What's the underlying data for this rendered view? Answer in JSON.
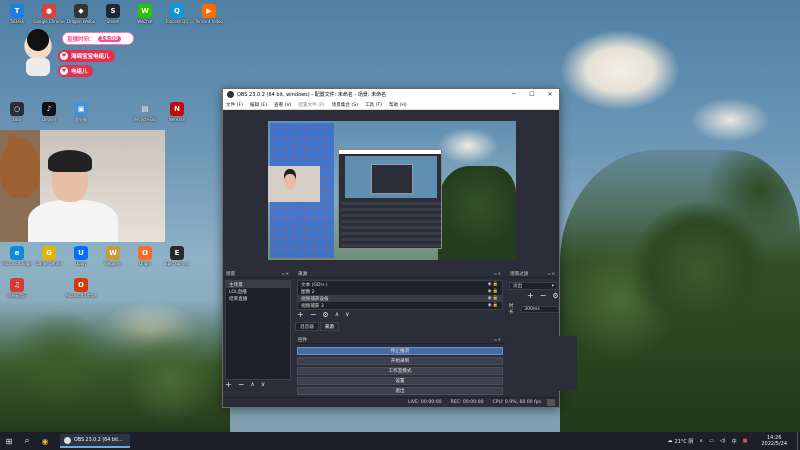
{
  "desktop": {
    "icons": [
      {
        "label": "ToDesk",
        "color": "#1e7de0",
        "glyph": "T"
      },
      {
        "label": "Google Chrome",
        "color": "#d9423a",
        "glyph": "●"
      },
      {
        "label": "Dragon Weibo",
        "color": "#333333",
        "glyph": "◆"
      },
      {
        "label": "Steam",
        "color": "#1b2838",
        "glyph": "S"
      },
      {
        "label": "WeChat",
        "color": "#2dc100",
        "glyph": "W"
      },
      {
        "label": "Tencent QQ",
        "color": "#1296db",
        "glyph": "Q"
      },
      {
        "label": "Tencent Video",
        "color": "#ff6a00",
        "glyph": "▶"
      },
      {
        "label": "OBS",
        "color": "#2b2e38",
        "glyph": "○"
      },
      {
        "label": "Douyin",
        "color": "#111111",
        "glyph": "♪"
      },
      {
        "label": "此电脑",
        "color": "#4a90d9",
        "glyph": "▣"
      },
      {
        "label": "Recycle Bin",
        "color": "#6a8fb0",
        "glyph": "▤"
      },
      {
        "label": "Netease",
        "color": "#c20c0c",
        "glyph": "N"
      },
      {
        "label": "Microsoft Edge",
        "color": "#0c8dd6",
        "glyph": "e"
      },
      {
        "label": "Game Center",
        "color": "#e0b400",
        "glyph": "G"
      },
      {
        "label": "Uplay",
        "color": "#0070ff",
        "glyph": "U"
      },
      {
        "label": "Wegame",
        "color": "#c89b3c",
        "glyph": "W"
      },
      {
        "label": "Origin",
        "color": "#f56c2d",
        "glyph": "O"
      },
      {
        "label": "Epic Games",
        "color": "#2a2a2a",
        "glyph": "E"
      },
      {
        "label": "网易云音乐",
        "color": "#d43c33",
        "glyph": "♫"
      },
      {
        "label": "Microsoft Office",
        "color": "#d83b01",
        "glyph": "O"
      }
    ]
  },
  "overlay": {
    "live_label": "直播时间：",
    "live_time": "14:00",
    "tag1": "海绵宝宝电组儿",
    "tag2": "电组儿"
  },
  "obs": {
    "title": "OBS 23.0.2 (64 bit, windows) - 配置文件: 未命名 - 场景: 未命名",
    "menu": [
      "文件 (F)",
      "编辑 (E)",
      "查看 (V)",
      "配置文件 (P)",
      "场景集合 (S)",
      "工具 (T)",
      "帮助 (H)"
    ],
    "scenes": {
      "header": "场景",
      "items": [
        "主场景",
        "LOL直播",
        "结束直播"
      ]
    },
    "sources": {
      "header": "来源",
      "items": [
        "文本 (GDI+)",
        "图像 2",
        "视频捕获设备",
        "视频捕获 3"
      ]
    },
    "mixer_tab": "混音器",
    "source_tab": "来源",
    "controls": {
      "header": "控件",
      "buttons": [
        "停止推流",
        "开始录制",
        "工作室模式",
        "设置",
        "退出"
      ]
    },
    "transitions": {
      "header": "场景过渡",
      "selected": "淡出",
      "duration_label": "时长",
      "duration_value": "300ms"
    },
    "status": {
      "live": "LIVE: 00:00:00",
      "rec": "REC: 00:00:00",
      "cpu": "CPU: 0.9%, 60.00 fps"
    }
  },
  "taskbar": {
    "task_label": "OBS 23.0.2 (64 bit...",
    "weather": "21°C 阴",
    "ime": "中",
    "time": "14:26",
    "date": "2022/5/24"
  }
}
